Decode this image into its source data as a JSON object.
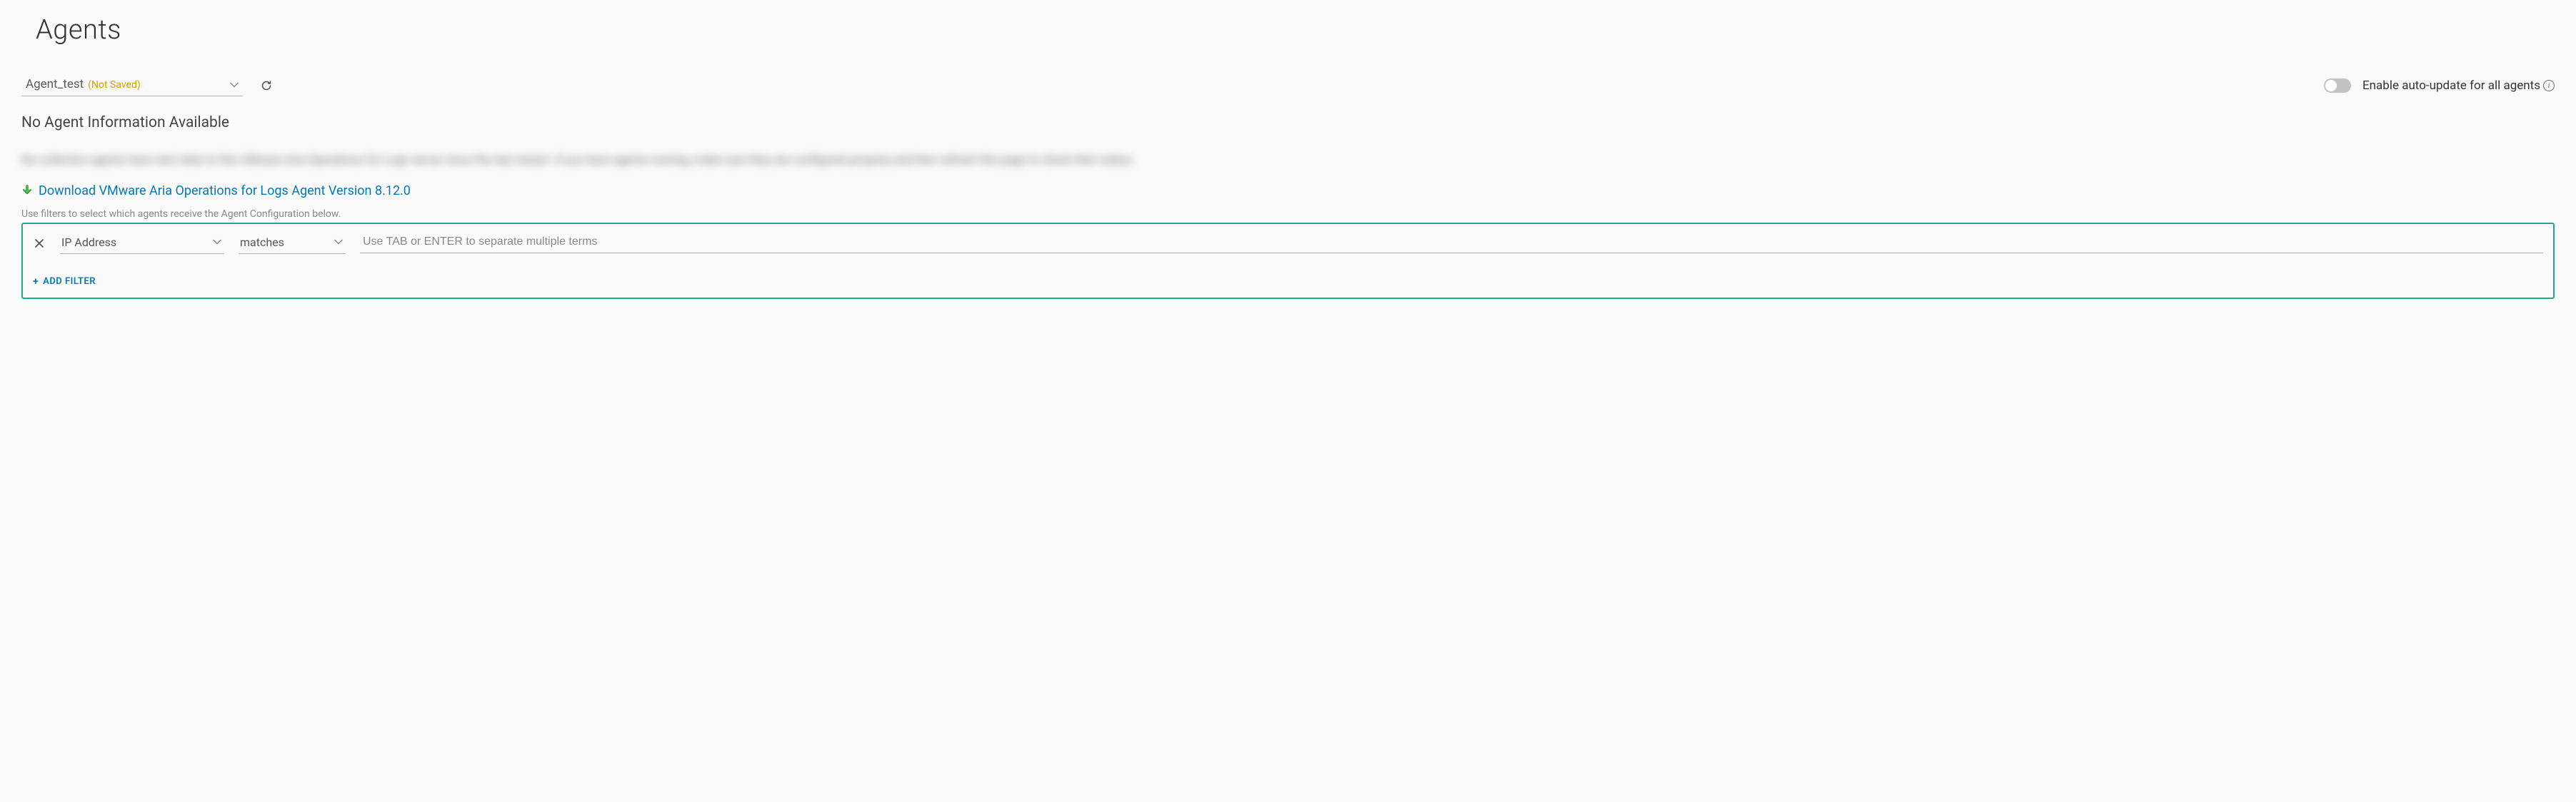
{
  "page": {
    "title": "Agents"
  },
  "agent_select": {
    "name": "Agent_test",
    "status": "(Not Saved)"
  },
  "auto_update": {
    "label": "Enable auto-update for all agents",
    "enabled": false
  },
  "status_message": "No Agent Information Available",
  "blurred_paragraph": "No collection agents have sent data to this VMware Aria Operations for Logs server since the last restart. If you have agents running, make sure they are configured properly and then refresh this page to check their status.",
  "download": {
    "label": "Download VMware Aria Operations for Logs Agent Version 8.12.0"
  },
  "filter_hint": "Use filters to select which agents receive the Agent Configuration below.",
  "filter": {
    "field": "IP Address",
    "operator": "matches",
    "value": "",
    "placeholder": "Use TAB or ENTER to separate multiple terms"
  },
  "add_filter_label": "ADD FILTER"
}
